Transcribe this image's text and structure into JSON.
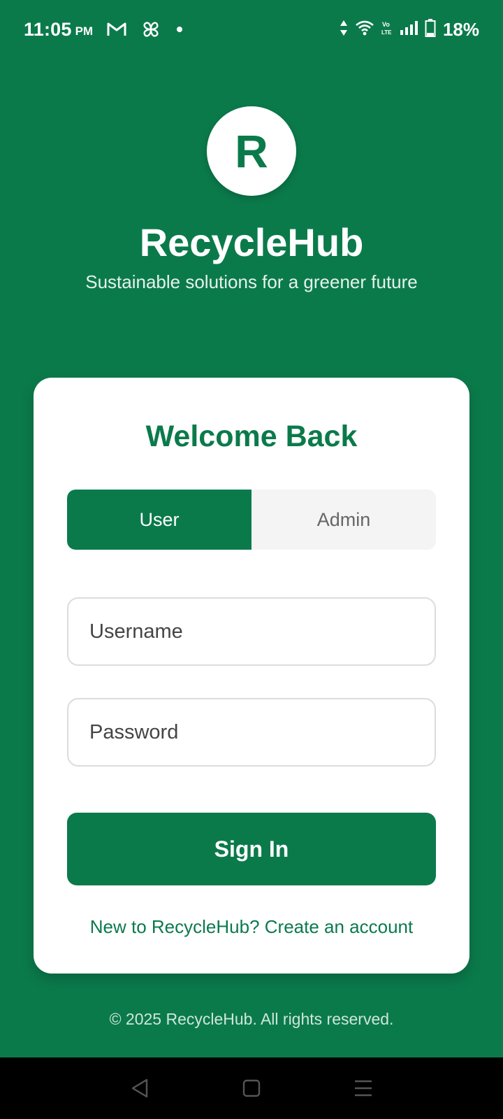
{
  "status_bar": {
    "time": "11:05",
    "ampm": "PM",
    "battery": "18%",
    "icons": [
      "gmail-icon",
      "pinwheel-icon",
      "notification-dot-icon",
      "data-arrows-icon",
      "wifi-icon",
      "volte-icon",
      "signal-icon",
      "battery-icon"
    ]
  },
  "header": {
    "logo_letter": "R",
    "title": "RecycleHub",
    "tagline": "Sustainable solutions for a greener future"
  },
  "login_card": {
    "title": "Welcome Back",
    "roles": [
      {
        "label": "User",
        "active": true
      },
      {
        "label": "Admin",
        "active": false
      }
    ],
    "username_placeholder": "Username",
    "password_placeholder": "Password",
    "signin_label": "Sign In",
    "signup_text": "New to RecycleHub? Create an account"
  },
  "footer": {
    "copyright": "© 2025 RecycleHub. All rights reserved."
  },
  "nav_bar": {
    "icons": [
      "back-icon",
      "home-icon",
      "menu-icon"
    ]
  },
  "colors": {
    "brand_green": "#0b7a4b",
    "background_white": "#ffffff"
  }
}
